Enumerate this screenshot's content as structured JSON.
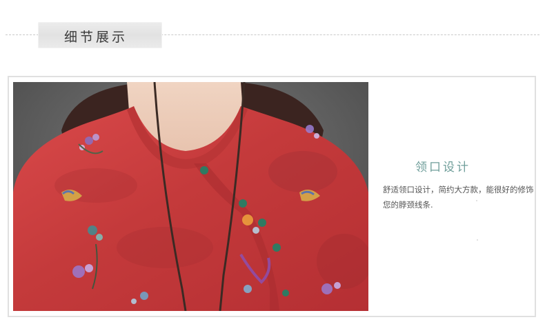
{
  "header": {
    "title": "细节展示"
  },
  "detail": {
    "title": "领口设计",
    "description": "舒适领口设计，简约大方款，能很好的修饰您的脖颈线条."
  },
  "photo": {
    "subject": "red-floral-print-blouse-collar",
    "accent_color": "#c63b3b"
  },
  "colors": {
    "title_text": "#3a3a3a",
    "detail_title": "#6f9e9a",
    "body_text": "#555555"
  }
}
